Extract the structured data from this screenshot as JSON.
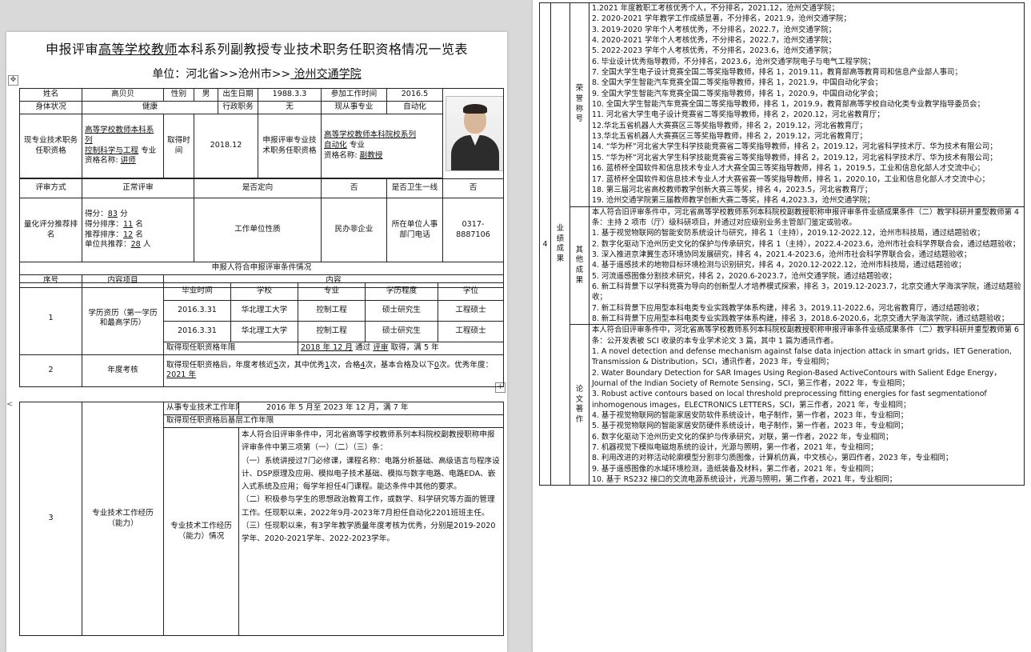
{
  "left_page": {
    "title_pre": "申报评审",
    "title_u1": "高等学校教师",
    "title_mid": "本科系列副教授",
    "title_u2": "",
    "title_post": "专业技术职务任职资格情况一览表",
    "unit_prefix": "单位：河北省>>沧州市>>",
    "unit_name": " 沧州交通学院 ",
    "handle_move": "✥",
    "handle_add": "+",
    "side_arrow": "<",
    "rows": {
      "name_label": "姓名",
      "name_value": "高贝贝",
      "gender_label": "性别",
      "gender_value": "男",
      "birth_label": "出生日期",
      "birth_value": "1988.3.3",
      "work_label": "参加工作时间",
      "work_value": "2016.5",
      "health_label": "身体状况",
      "health_value": "健康",
      "admin_label": "行政职务",
      "admin_value": "无",
      "dept_label": "现从事专业",
      "dept_value": "自动化",
      "cur_qual_label": "现专业技术职务任职资格",
      "cur_qual_line1": "高等学校教师本科系列",
      "cur_qual_line2": "控制科学与工程",
      "cur_qual_line2_suffix": "专业",
      "cur_qual_line3_label": "资格名称:",
      "cur_qual_line3_value": "讲师",
      "get_time_label": "取得时间",
      "get_time_value": "2018.12",
      "apply_label": "申报评审专业技术职务任职资格",
      "apply_line1": "高等学校教师本科院校系列",
      "apply_line2": "自动化",
      "apply_line2_suffix": "专业",
      "apply_line3_label": "资格名称:",
      "apply_line3_value": "副教授",
      "review_mode_label": "评审方式",
      "review_mode_value": "正常评审",
      "directed_label": "是否定向",
      "directed_value": "否",
      "health_line_label": "是否卫生一线",
      "health_line_value": "否",
      "score_label": "量化评分推荐排名",
      "score_text": "得分：",
      "score_value": "83",
      "score_unit": "分",
      "score_rank_text": "得分排序：",
      "score_rank_value": "11",
      "score_rank_unit": "名",
      "rec_rank_text": "推荐排序：",
      "rec_rank_value": "12",
      "rec_rank_unit": "名",
      "unit_rec_text": "单位共推荐：",
      "unit_rec_value": "28",
      "unit_rec_unit": "人",
      "unit_nature_label": "工作单位性质",
      "unit_nature_value": "民办非企业",
      "hr_phone_label": "所在单位人事部门电话",
      "hr_phone_value": "0317-8887106",
      "section_header": "申报人符合申报评审条件情况",
      "col_no": "序号",
      "col_item": "内容项目",
      "col_content": "内容",
      "edu_no": "1",
      "edu_item": "学历资历（第一学历和最高学历）",
      "edu_headers": [
        "毕业时间",
        "学校",
        "专业",
        "学历程度",
        "学位"
      ],
      "edu_rows": [
        [
          "2016.3.31",
          "华北理工大学",
          "控制工程",
          "硕士研究生",
          "工程硕士"
        ],
        [
          "2016.3.31",
          "华北理工大学",
          "控制工程",
          "硕士研究生",
          "工程硕士"
        ]
      ],
      "edu_years_label": "取得现任职资格年限",
      "edu_years_p1": "2018 年 12 月",
      "edu_years_p2": "通过",
      "edu_years_p3": "评审",
      "edu_years_p4": "取得，满 5 年",
      "assess_no": "2",
      "assess_item": "年度考核",
      "assess_text_a": "取得现任职资格后，年度考核近",
      "assess_n1": "5",
      "assess_text_b": "次，其中优秀",
      "assess_n2": "1",
      "assess_text_c": "次，合格",
      "assess_n3": "4",
      "assess_text_d": "次，基本合格及以下",
      "assess_n4": "0",
      "assess_text_e": "次。优秀年度：",
      "assess_years": "2021 年",
      "exp_no": "3",
      "exp_item": "专业技术工作经历（能力）",
      "exp_years_label": "从事专业技术工作年限",
      "exp_years_value": "2016 年  5 月至  2023 年   12 月，满  7 年",
      "exp_base_label": "取得现任职资格后基层工作年限",
      "exp_base_value": "",
      "exp_sub_label": "专业技术工作经历（能力）情况",
      "exp_paragraphs": [
        "本人符合旧评审条件中，河北省高等学校教师系列本科院校副教授职称申报评审条件中第三项第（一）（二）（三）条：",
        "（一）系统讲授过7门必修课，课程名称：电路分析基础、高级语言与程序设计、DSP原理及应用、模拟电子技术基础、模拟与数字电路、电路EDA、嵌入式系统及应用；每学年担任4门课程。能达条件中其他的要求。",
        "（二）积极参与学生的思想政治教育工作，或数学、科学研究等方面的管理工作。任现职以来，2022年9月-2023年7月担任自动化2201班班主任。",
        "（三）任现职以来，有3学年教学质量年度考核为优秀，分别是2019-2020学年、2020-2021学年、2022-2023学年。"
      ]
    }
  },
  "right_page": {
    "row_no": "4",
    "main_label": "业绩成果",
    "honor_label": "荣誉称号",
    "honor_items": [
      "1.2021 年度教职工考核优秀个人，不分排名，2021.12，沧州交通学院；",
      "2. 2020-2021 学年教学工作成绩显著，不分排名，2021.9，沧州交通学院；",
      "3. 2019-2020 学年个人考核优秀，不分排名，2022.7，沧州交通学院；",
      "4. 2020-2021 学年个人考核优秀，不分排名，2022.7，沧州交通学院；",
      "5. 2022-2023 学年个人考核优秀，不分排名，2023.6，沧州交通学院；",
      "6. 毕业设计优秀指导教师，不分排名，2023.6，沧州交通学院电子与电气工程学院；",
      "7. 全国大学生电子设计竞赛全国二等奖指导教师，排名 1，2019.11，教育部高等教育司和信息产业部人事司；",
      "8. 全国大学生智能汽车竞赛全国二等奖指导教师，排名 1，2021.9，中国自动化学会；",
      "9. 全国大学生智能汽车竞赛全国二等奖指导教师，排名 1，2020.9，中国自动化学会；",
      "10. 全国大学生智能汽车竞赛全国二等奖指导教师，排名 1，2019.9，教育部高等学校自动化类专业教学指导委员会；",
      "11. 河北省大学生电子设计竞赛省二等奖指导教师，排名 2，2020.12，河北省教育厅；",
      "12.华北五省机器人大赛赛区三等奖指导教师，排名 2，2019.12，河北省教育厅；",
      "13.华北五省机器人大赛赛区三等奖指导教师，排名 2，2019.12，河北省教育厅；",
      "14. “华为杯”河北省大学生科学技能竞赛省二等奖指导教师，排名 2，2019.12，河北省科学技术厅、华为技术有限公司；",
      "15. “华为杯”河北省大学生科学技能竞赛省三等奖指导教师，排名 2，2019.12，河北省科学技术厅、华为技术有限公司；",
      "16. 蓝桥杯全国软件和信息技术专业人才大赛全国三等奖指导教师，排名 1，2019.5，工业和信息化部人才交流中心；",
      "17. 蓝桥杯全国软件和信息技术专业人才大赛省赛一等奖指导教师，排名 1，2020.10，工业和信息化部人才交流中心；",
      "18. 第三届河北省高校教师教学创新大赛三等奖，排名 4，2023.5，河北省教育厅；",
      "19. 沧州交通学院第三届教师教学创新大赛二等奖，排名 4,2023.3，沧州交通学院；"
    ],
    "other_label": "其他成果",
    "other_items": [
      "本人符合旧评审条件中，河北省高等学校教师系列本科院校副教授职称申报评审条件业绩成果条件（二）教学科研并重型教师第 4 条：主持 2 项市（厅）级科研项目，并通过对应级别业务主管部门鉴定或验收。",
      "1. 基于视觉物联网的智能安防系统设计与研究，排名 1（主持），2019.12-2022.12，沧州市科技局，通过结题验收；",
      "2. 数字化驱动下沧州历史文化的保护与传承研究，排名 1（主持），2022.4-2023.6，沧州市社会科学界联合会，通过结题验收；3. 深入推进京津冀生态环境协同发展研究，排名 4，2021.4-2023.6，沧州市社会科学界联合会，通过结题验收；",
      "4. 基于遥感技术的地物目标环境检测与识别研究，排名 4，2020.12-2022.12，沧州市科技局，通过结题验收；",
      "5. 河流遥感图像分割技术研究，排名 2，2020.6-2023.7，沧州交通学院，通过结题验收；",
      "6. 新工科背景下以学科竞赛为导向的创新型人才培养模式探索，排名 3，2019.12-2023.7，北京交通大学海滨学院，通过结题验收；",
      "7. 新工科背景下应用型本科电类专业实践教学体系构建，排名 3，2019.11-2022.6，河北省教育厅，通过结题验收；",
      "8. 新工科背景下应用型本科电类专业实践教学体系构建，排名 3，2018.6-2020.6，北京交通大学海滨学院，通过结题验收；"
    ],
    "papers_label": "论文著作",
    "papers_intro": "本人符合旧评审条件中，河北省高等学校教师系列本科院校副教授职称申报评审条件业绩成果条件（二）教学科研并重型教师第 6 条：公开发表被 SCI 收录的本专业学术论文 3 篇，其中 1 篇为通讯作者。",
    "papers_items": [
      "1. A novel detection and defense mechanism against false data injection attack in smart grids，IET Generation, Transmission & Distribution，SCI，通讯作者，2023 年，专业相同；",
      "2. Water Boundary Detection for SAR Images Using Region-Based ActiveContours with Salient Edge Energy，Journal of the Indian Society of Remote Sensing，SCI，第三作者，2022 年，专业相同；",
      "3. Robust active contours based on local threshold preprocessing fitting energies for fast segmentationof inhomogenous images，ELECTRONICS LETTERS，SCI，第三作者，2021 年，专业相同；",
      "4. 基于视觉物联网的智能家居安防软件系统设计，电子制作，第一作者，2023 年，专业相同；",
      "5. 基于视觉物联网的智能家居安防硬件系统设计，电子制作，第一作者，2023 年，专业相同；",
      "6. 数字化驱动下沧州历史文化的保护与传承研究，对联，第一作者，2022 年，专业相同；",
      "7. 机器视觉下模拟电磁炮系统的设计，光源与照明，第一作者，2021 年，专业相同；",
      "8. 利用改进的对称活动轮廓模型分割非匀质图像，计算机仿真，中文核心，第四作者，2023 年，专业相同；",
      "9. 基于遥感图像的水域环境检测，造纸装备及材料，第二作者，2021 年，专业相同；",
      "10. 基于 RS232 接口的交流电源系统设计，光源与照明，第二作者，2021 年，专业相同；"
    ]
  }
}
